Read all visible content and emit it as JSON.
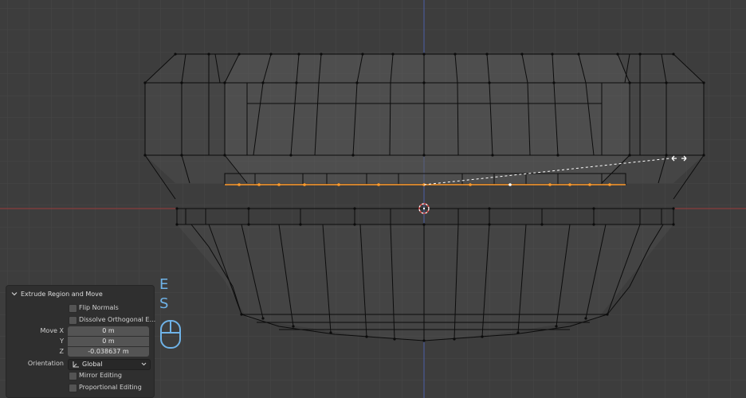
{
  "operator_panel": {
    "title": "Extrude Region and Move",
    "flip_normals": "Flip Normals",
    "dissolve_orthogonal": "Dissolve Orthogonal E...",
    "move_x_label": "Move X",
    "y_label": "Y",
    "z_label": "Z",
    "move_x_value": "0 m",
    "move_y_value": "0 m",
    "move_z_value": "-0.038637 m",
    "orientation_label": "Orientation",
    "orientation_value": "Global",
    "mirror_editing": "Mirror Editing",
    "proportional_editing": "Proportional Editing"
  },
  "key_hints": [
    "E",
    "S"
  ],
  "colors": {
    "background": "#3d3d3d",
    "grid": "#484848",
    "x_axis": "#9a3a3a",
    "y_axis": "#4a5fa8",
    "wire": "#0c0c0c",
    "selected": "#ff9a2a",
    "key_hint": "#6fb3e8"
  }
}
